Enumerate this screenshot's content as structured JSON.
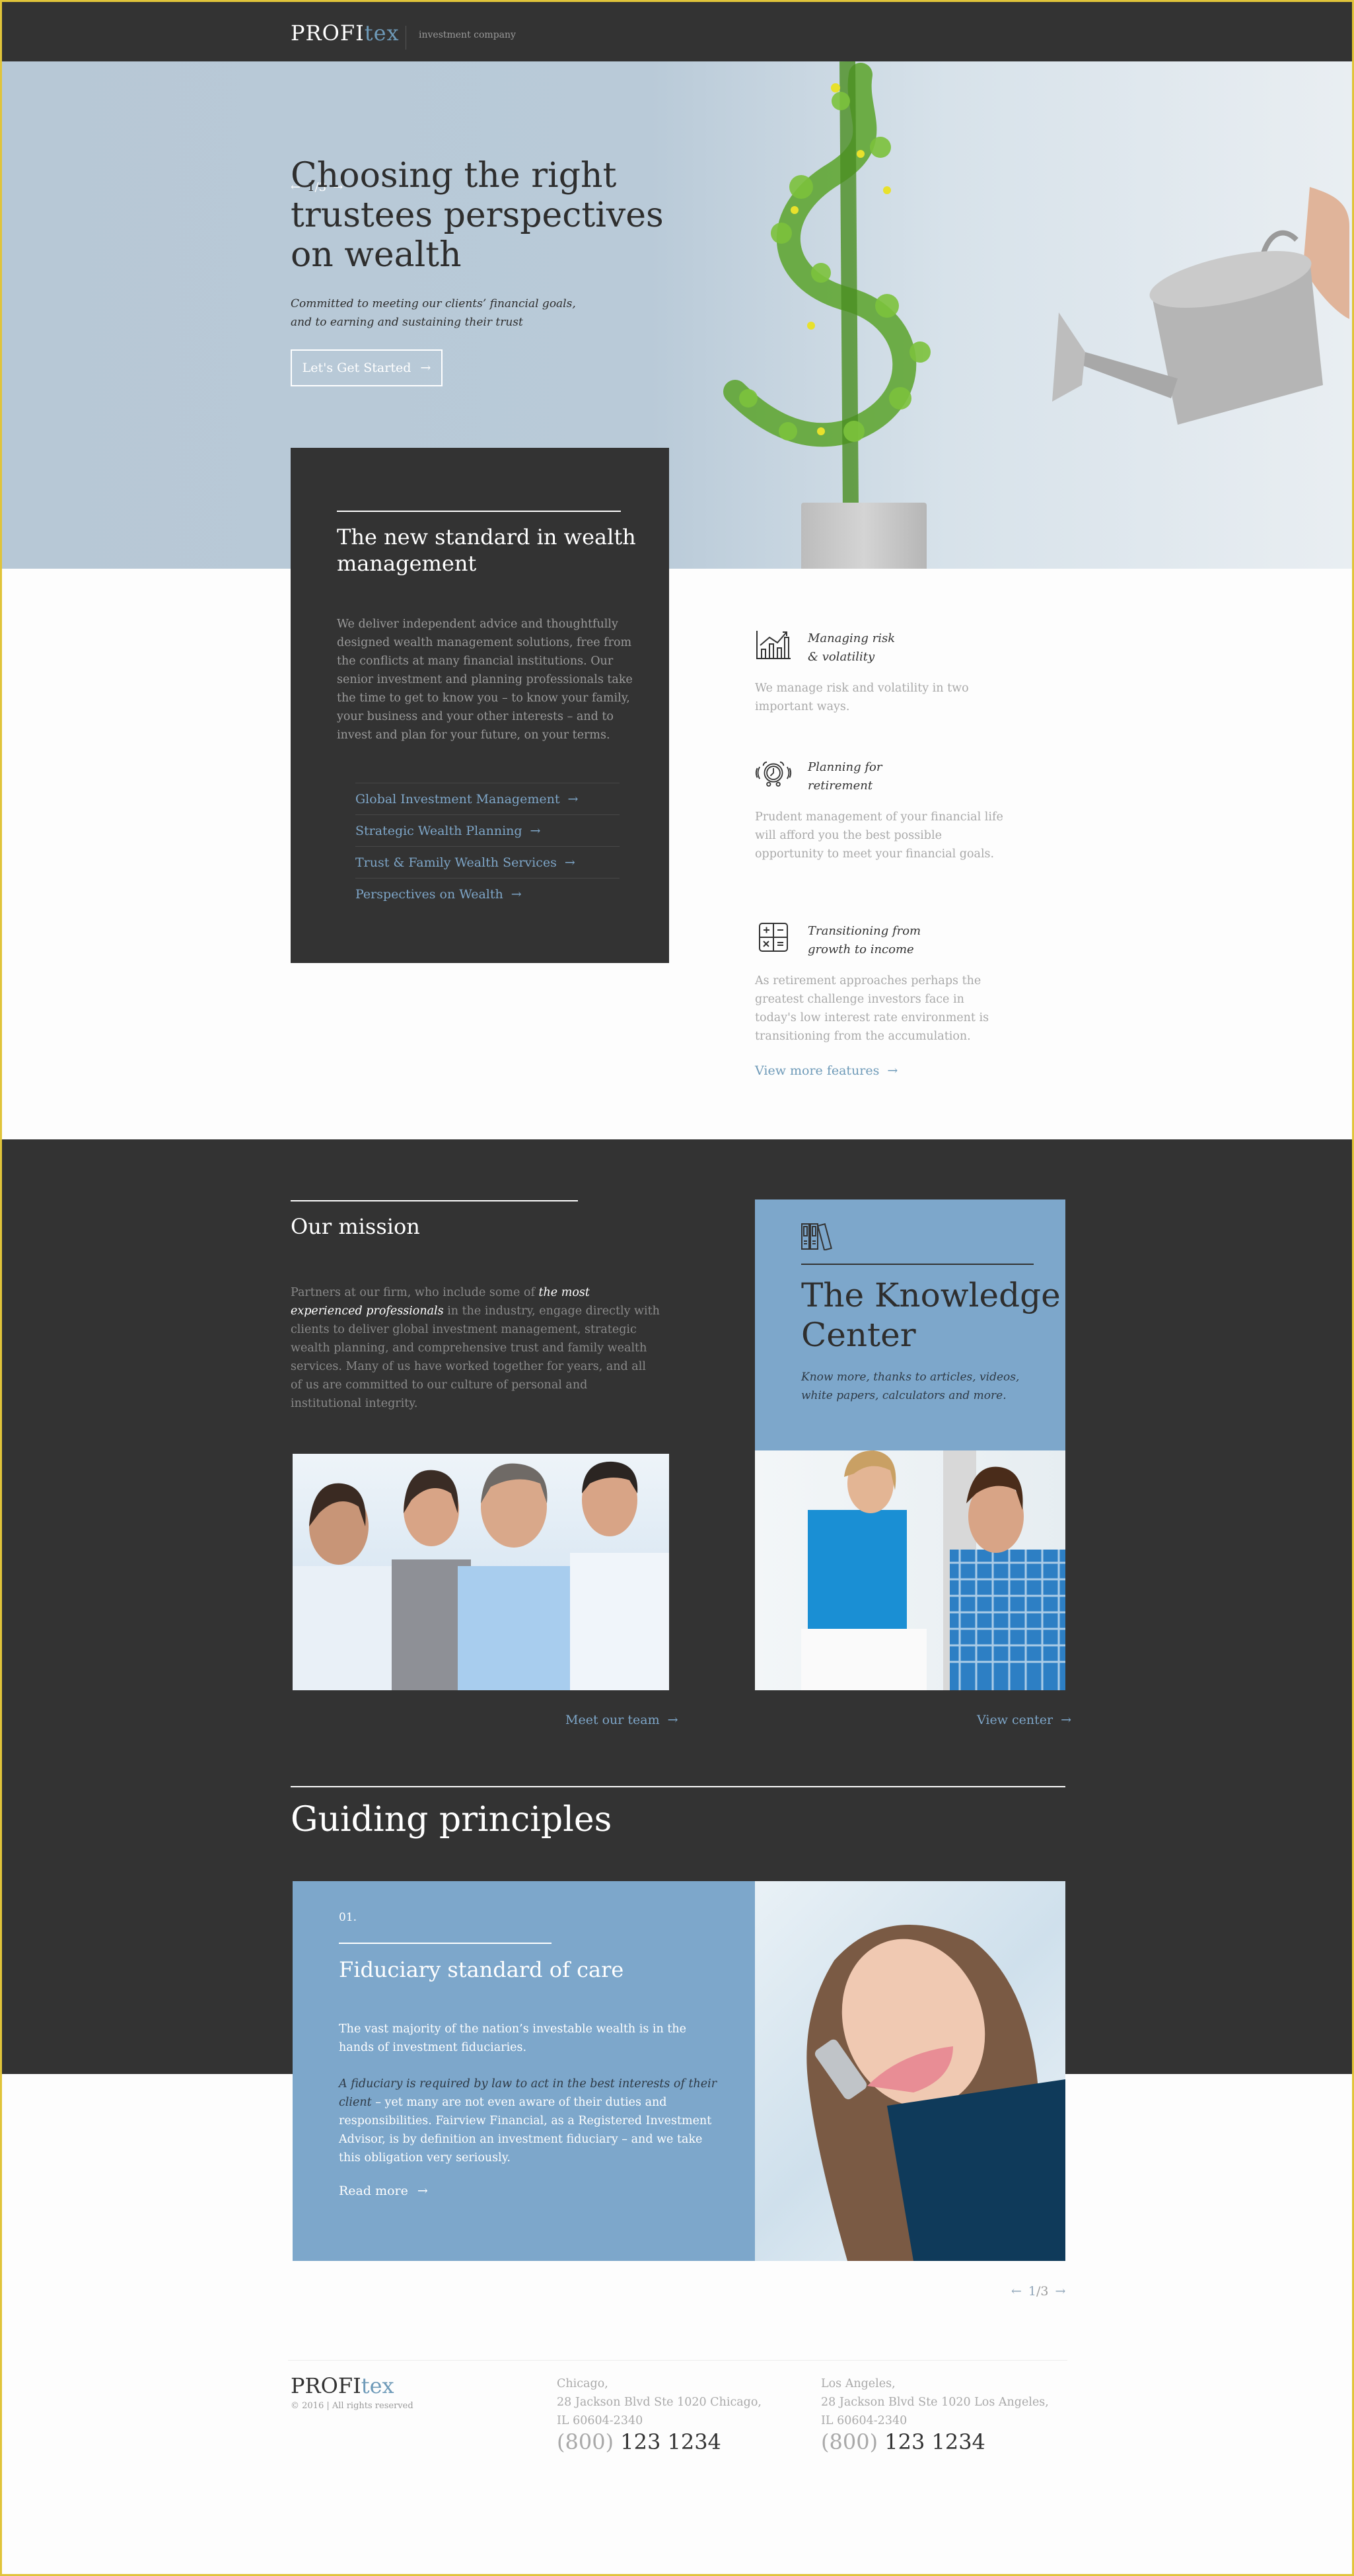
{
  "header": {
    "logo_main": "PROFI",
    "logo_accent": "tex",
    "tagline": "investment company"
  },
  "hero": {
    "slide_current": "1",
    "slide_total": "/3",
    "title": "Choosing the right trustees perspectives on wealth",
    "subtitle": "Committed to meeting our clients’ financial goals, and to earning and sustaining their trust",
    "cta_label": "Let's Get Started"
  },
  "standard_card": {
    "title": "The new standard in wealth management",
    "body": "We deliver independent advice and thoughtfully designed wealth management solutions, free from the conflicts at many financial institutions. Our senior investment and planning professionals take the time to get to know you – to know your family, your business and your other interests – and to invest and plan for your future, on your terms.",
    "links": [
      {
        "label": "Global Investment Management"
      },
      {
        "label": "Strategic Wealth Planning"
      },
      {
        "label": "Trust & Family Wealth Services"
      },
      {
        "label": "Perspectives on Wealth"
      }
    ]
  },
  "features": {
    "items": [
      {
        "icon": "growth-chart-icon",
        "title_line1": "Managing risk",
        "title_line2": "& volatility",
        "text": "We manage risk and volatility in two important ways."
      },
      {
        "icon": "alarm-clock-icon",
        "title_line1": "Planning for",
        "title_line2": "retirement",
        "text": "Prudent management of your financial life will afford you the best possible opportunity to meet your financial goals."
      },
      {
        "icon": "calculator-icon",
        "title_line1": "Transitioning from",
        "title_line2": "growth to income",
        "text": "As retirement approaches perhaps the greatest challenge investors face in today's low interest rate environment is transitioning from the accumulation."
      }
    ],
    "view_more_label": "View more features"
  },
  "mission": {
    "title": "Our mission",
    "body_before": "Partners at our firm, who include some of ",
    "body_emphasis": "the most experienced professionals",
    "body_after": " in the industry, engage directly with clients to deliver global investment management, strategic wealth planning, and comprehensive trust and family wealth services. Many of us have worked together for years, and all of us are committed to our culture of personal and institutional integrity.",
    "link_label": "Meet our team"
  },
  "knowledge_center": {
    "title": "The Knowledge Center",
    "subtitle": "Know more, thanks to articles, videos, white papers, calculators and more.",
    "link_label": "View center"
  },
  "principles": {
    "title": "Guiding principles",
    "number": "01.",
    "item_title": "Fiduciary standard of care",
    "body1": "The vast majority of the nation’s investable wealth is in the hands of investment fiduciaries.",
    "body2_emphasis": "A fiduciary is required by law to act in the best interests of their client",
    "body2_rest": " – yet many are not even aware of their duties and responsibilities. Fairview Financial, as a Registered Investment Advisor, is by definition an investment fiduciary – and we take this obligation very seriously.",
    "read_more_label": "Read more",
    "pager_current": "1",
    "pager_total": "/3"
  },
  "footer": {
    "logo_main": "PROFI",
    "logo_accent": "tex",
    "copyright": "© 2016 | All rights reserved",
    "offices": [
      {
        "city": "Chicago,",
        "address1": "28 Jackson Blvd Ste 1020 Chicago,",
        "address2": "IL 60604-2340",
        "phone_area": "(800)",
        "phone_number": "123 1234"
      },
      {
        "city": "Los Angeles,",
        "address1": "28 Jackson Blvd Ste 1020 Los Angeles,",
        "address2": "IL 60604-2340",
        "phone_area": "(800)",
        "phone_number": "123 1234"
      }
    ]
  },
  "colors": {
    "dark": "#333333",
    "accent_blue": "#7da7cb",
    "link_blue": "#6e9ab8",
    "muted_text": "#a9a9a9",
    "frame_yellow": "#e0c43a"
  }
}
